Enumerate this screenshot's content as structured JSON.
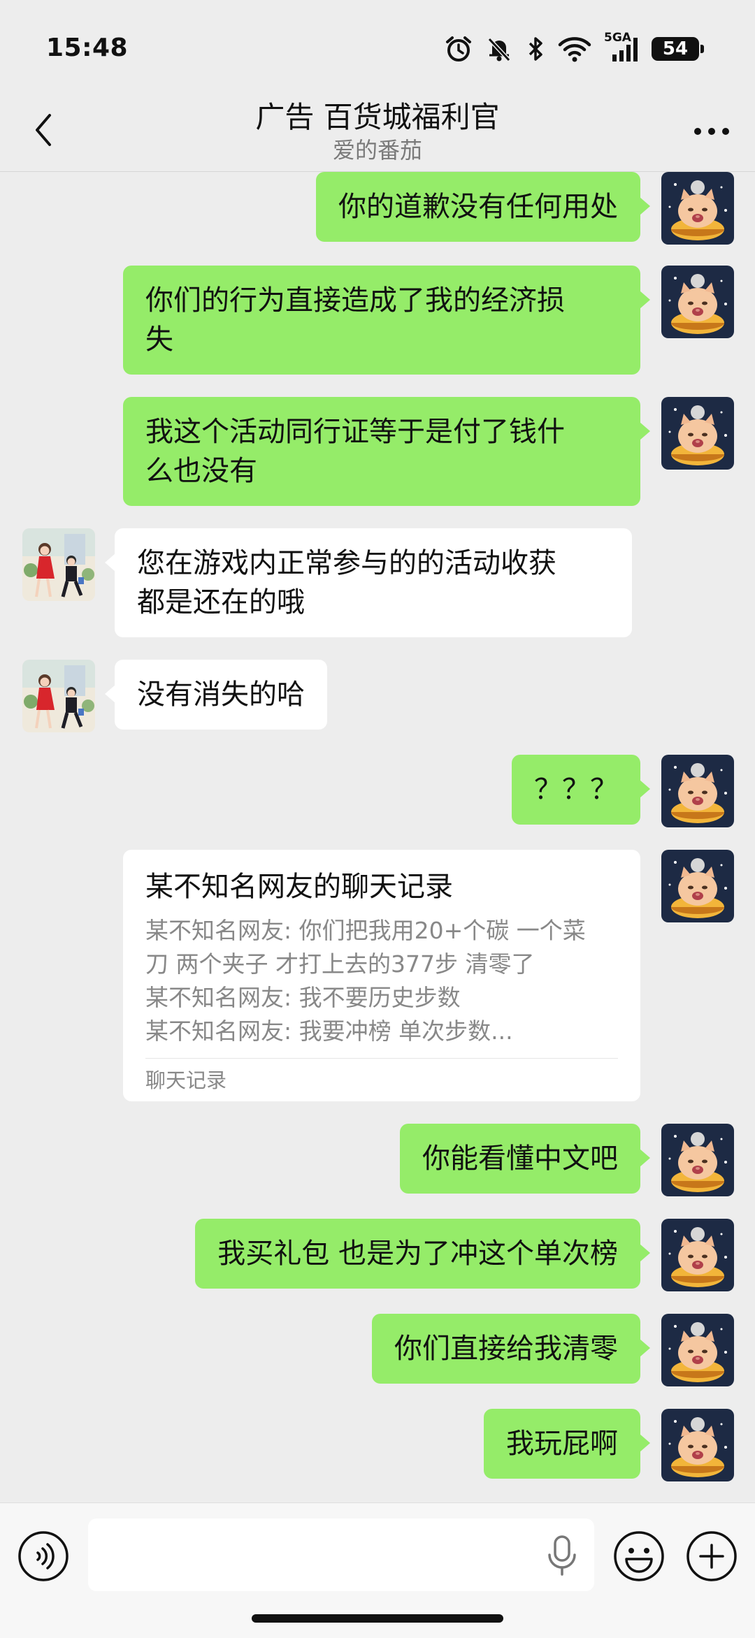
{
  "status_bar": {
    "time": "15:48",
    "network": "5GA",
    "battery": "54",
    "icons": [
      "alarm-icon",
      "mute-bell-icon",
      "bluetooth-icon",
      "wifi-icon",
      "signal-icon",
      "battery-icon"
    ]
  },
  "header": {
    "title": "广告 百货城福利官",
    "subtitle": "爱的番茄"
  },
  "messages": [
    {
      "sender": "me",
      "lines": [
        "你的道歉没有任何用处"
      ]
    },
    {
      "sender": "me",
      "lines": [
        "你们的行为直接造成了我的经济损",
        "失"
      ]
    },
    {
      "sender": "me",
      "lines": [
        "我这个活动同行证等于是付了钱什",
        "么也没有"
      ]
    },
    {
      "sender": "other",
      "lines": [
        "您在游戏内正常参与的的活动收获",
        "都是还在的哦"
      ]
    },
    {
      "sender": "other",
      "lines": [
        "没有消失的哈"
      ]
    },
    {
      "sender": "me",
      "lines": [
        "？？？"
      ]
    },
    {
      "sender": "me",
      "type": "chat_record",
      "title": "某不知名网友的聊天记录",
      "lines": [
        "某不知名网友: 你们把我用20+个碳 一个菜",
        "刀 两个夹子 才打上去的377步 清零了",
        "某不知名网友: 我不要历史步数",
        "某不知名网友: 我要冲榜 单次步数..."
      ],
      "footer": "聊天记录"
    },
    {
      "sender": "me",
      "lines": [
        "你能看懂中文吧"
      ]
    },
    {
      "sender": "me",
      "lines": [
        "我买礼包 也是为了冲这个单次榜"
      ]
    },
    {
      "sender": "me",
      "lines": [
        "你们直接给我清零"
      ]
    },
    {
      "sender": "me",
      "lines": [
        "我玩屁啊"
      ]
    }
  ],
  "input": {
    "value": "",
    "placeholder": ""
  },
  "colors": {
    "bubble_me": "#95ec69",
    "bubble_other": "#ffffff",
    "background": "#ededed"
  }
}
